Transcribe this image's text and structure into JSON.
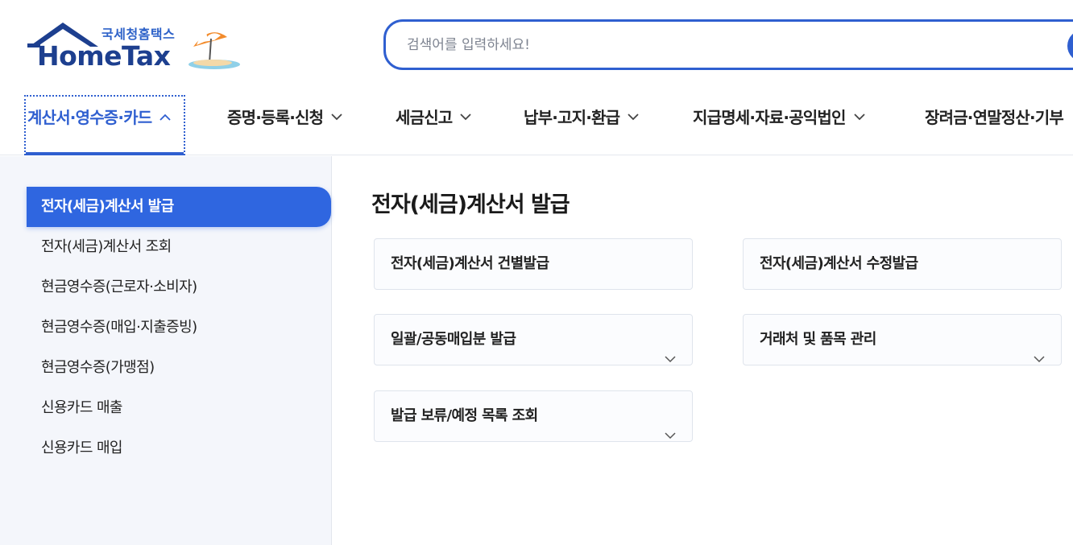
{
  "logo": {
    "korean": "국세청홈택스",
    "english": "HomeTax"
  },
  "search": {
    "placeholder": "검색어를 입력하세요!"
  },
  "gnb": {
    "items": [
      {
        "label": "계산서·영수증·카드",
        "expanded": true
      },
      {
        "label": "증명·등록·신청"
      },
      {
        "label": "세금신고"
      },
      {
        "label": "납부·고지·환급"
      },
      {
        "label": "지급명세·자료·공익법인"
      },
      {
        "label": "장려금·연말정산·기부"
      }
    ]
  },
  "lnb": {
    "items": [
      {
        "label": "전자(세금)계산서 발급",
        "active": true
      },
      {
        "label": "전자(세금)계산서 조회"
      },
      {
        "label": "현금영수증(근로자·소비자)"
      },
      {
        "label": "현금영수증(매입·지출증빙)"
      },
      {
        "label": "현금영수증(가맹점)"
      },
      {
        "label": "신용카드 매출"
      },
      {
        "label": "신용카드 매입"
      }
    ]
  },
  "main": {
    "title": "전자(세금)계산서 발급",
    "cards": [
      {
        "label": "전자(세금)계산서 건별발급"
      },
      {
        "label": "전자(세금)계산서 수정발급"
      },
      {
        "label": "일괄/공동매입분 발급",
        "has_dropdown": true
      },
      {
        "label": "거래처 및 품목 관리",
        "has_dropdown": true
      },
      {
        "label": "발급 보류/예정 목록 조회",
        "has_dropdown": true
      }
    ]
  },
  "colors": {
    "accent": "#2f5fd0",
    "active_menu_bg": "#2f66e0",
    "logo_navy": "#1d3f8f",
    "sidebar_bg": "#f4f6fb"
  }
}
